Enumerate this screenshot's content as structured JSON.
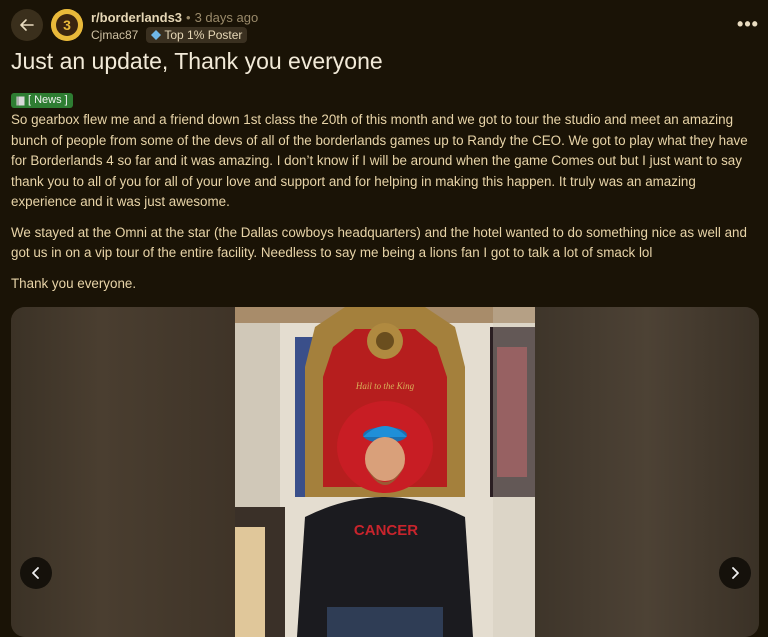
{
  "header": {
    "subreddit": "r/borderlands3",
    "separator": "•",
    "posted_ago": "3 days ago",
    "username": "Cjmac87",
    "user_badge": "Top 1% Poster",
    "more_label": "•••"
  },
  "post": {
    "title": "Just an update, Thank you everyone",
    "flair": "[ News ]",
    "paragraphs": [
      "So gearbox flew me and a friend down 1st class the 20th of this month and we got to tour the studio and meet an amazing bunch of people from some of the devs of all of the borderlands games up to Randy the CEO. We got to play what they have for Borderlands 4 so far and it was amazing. I don’t know if I will be around when the game Comes out but I just want to say thank you to all of you for all of your love and support and for helping in making this happen. It truly was an amazing experience and it was just awesome.",
      "We stayed at the Omni at the star (the Dallas cowboys headquarters) and the hotel wanted to do something nice as well and got us in on a vip tour of the entire facility. Needless to say me being a lions fan I got to talk a lot of smack lol",
      "Thank you everyone."
    ]
  },
  "gallery": {
    "throne_text": "Hail to the King",
    "shirt_text": "CANCER"
  },
  "colors": {
    "background": "#1a1306",
    "text": "#e8d4a8",
    "flair": "#2e7d32",
    "subreddit_avatar": "#e9b93a"
  }
}
